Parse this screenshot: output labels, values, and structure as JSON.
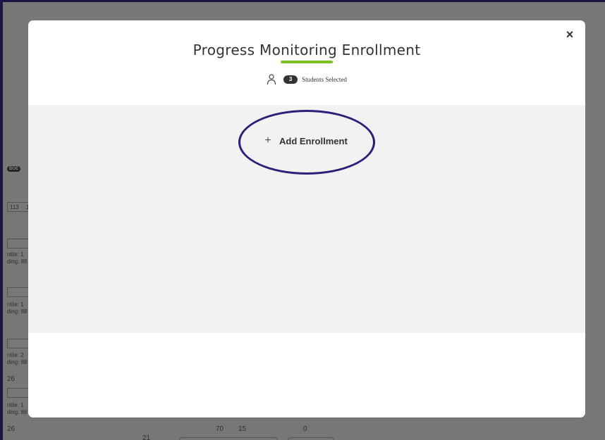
{
  "modal": {
    "title": "Progress Monitoring Enrollment",
    "close_label": "×",
    "students": {
      "count": "3",
      "label": "Students Selected"
    },
    "add_enrollment_label": "Add Enrollment",
    "plus_glyph": "+"
  },
  "background": {
    "badge": "BOE",
    "cells": [
      "113",
      "1"
    ],
    "row_labels": [
      "ntile: 1",
      "ding: 88",
      "ntile: 1",
      "ding: 88",
      "ntile: 2",
      "ding: 88",
      "ntile: 1",
      "ding: 88"
    ],
    "numbers": [
      "26",
      "26",
      "21",
      "70",
      "15",
      "0"
    ]
  },
  "colors": {
    "accent_underline": "#7cc21f",
    "highlight": "#2e1f7a",
    "frame": "#3a2b7a"
  }
}
